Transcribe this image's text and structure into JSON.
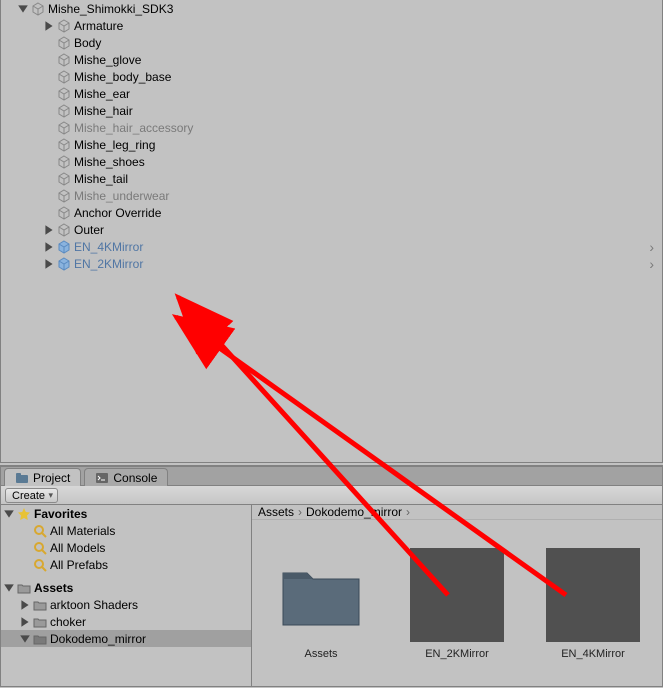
{
  "hierarchy": {
    "root": "Mishe_Shimokki_SDK3",
    "items": [
      {
        "label": "Armature",
        "hasChildren": true
      },
      {
        "label": "Body",
        "hasChildren": false
      },
      {
        "label": "Mishe_glove",
        "hasChildren": false
      },
      {
        "label": "Mishe_body_base",
        "hasChildren": false
      },
      {
        "label": "Mishe_ear",
        "hasChildren": false
      },
      {
        "label": "Mishe_hair",
        "hasChildren": false
      },
      {
        "label": "Mishe_hair_accessory",
        "hasChildren": false,
        "dim": true
      },
      {
        "label": "Mishe_leg_ring",
        "hasChildren": false
      },
      {
        "label": "Mishe_shoes",
        "hasChildren": false
      },
      {
        "label": "Mishe_tail",
        "hasChildren": false
      },
      {
        "label": "Mishe_underwear",
        "hasChildren": false,
        "dim": true
      },
      {
        "label": "Anchor Override",
        "hasChildren": false
      },
      {
        "label": "Outer",
        "hasChildren": true
      },
      {
        "label": "EN_4KMirror",
        "hasChildren": true,
        "prefab": true,
        "navArrow": true
      },
      {
        "label": "EN_2KMirror",
        "hasChildren": true,
        "prefab": true,
        "navArrow": true
      }
    ]
  },
  "tabs": {
    "project": "Project",
    "console": "Console"
  },
  "toolbar": {
    "create": "Create"
  },
  "favorites": {
    "heading": "Favorites",
    "items": [
      "All Materials",
      "All Models",
      "All Prefabs"
    ]
  },
  "assetsTree": {
    "heading": "Assets",
    "items": [
      {
        "label": "arktoon Shaders",
        "hasChildren": true
      },
      {
        "label": "choker",
        "hasChildren": true
      },
      {
        "label": "Dokodemo_mirror",
        "hasChildren": true,
        "selected": true,
        "expanded": true
      }
    ]
  },
  "breadcrumb": {
    "root": "Assets",
    "folder": "Dokodemo_mirror"
  },
  "grid": {
    "items": [
      {
        "label": "Assets",
        "type": "folder"
      },
      {
        "label": "EN_2KMirror",
        "type": "prefab-dark"
      },
      {
        "label": "EN_4KMirror",
        "type": "prefab-dark"
      }
    ]
  }
}
